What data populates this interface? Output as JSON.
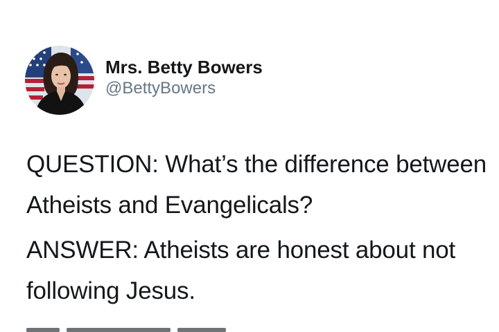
{
  "author": {
    "display_name": "Mrs. Betty Bowers",
    "handle": "@BettyBowers",
    "avatar_icon": "profile-photo-icon"
  },
  "tweet": {
    "paragraphs": [
      "QUESTION: What’s the difference between Atheists and Evangelicals?",
      "ANSWER: Atheists are honest about not following Jesus."
    ]
  }
}
